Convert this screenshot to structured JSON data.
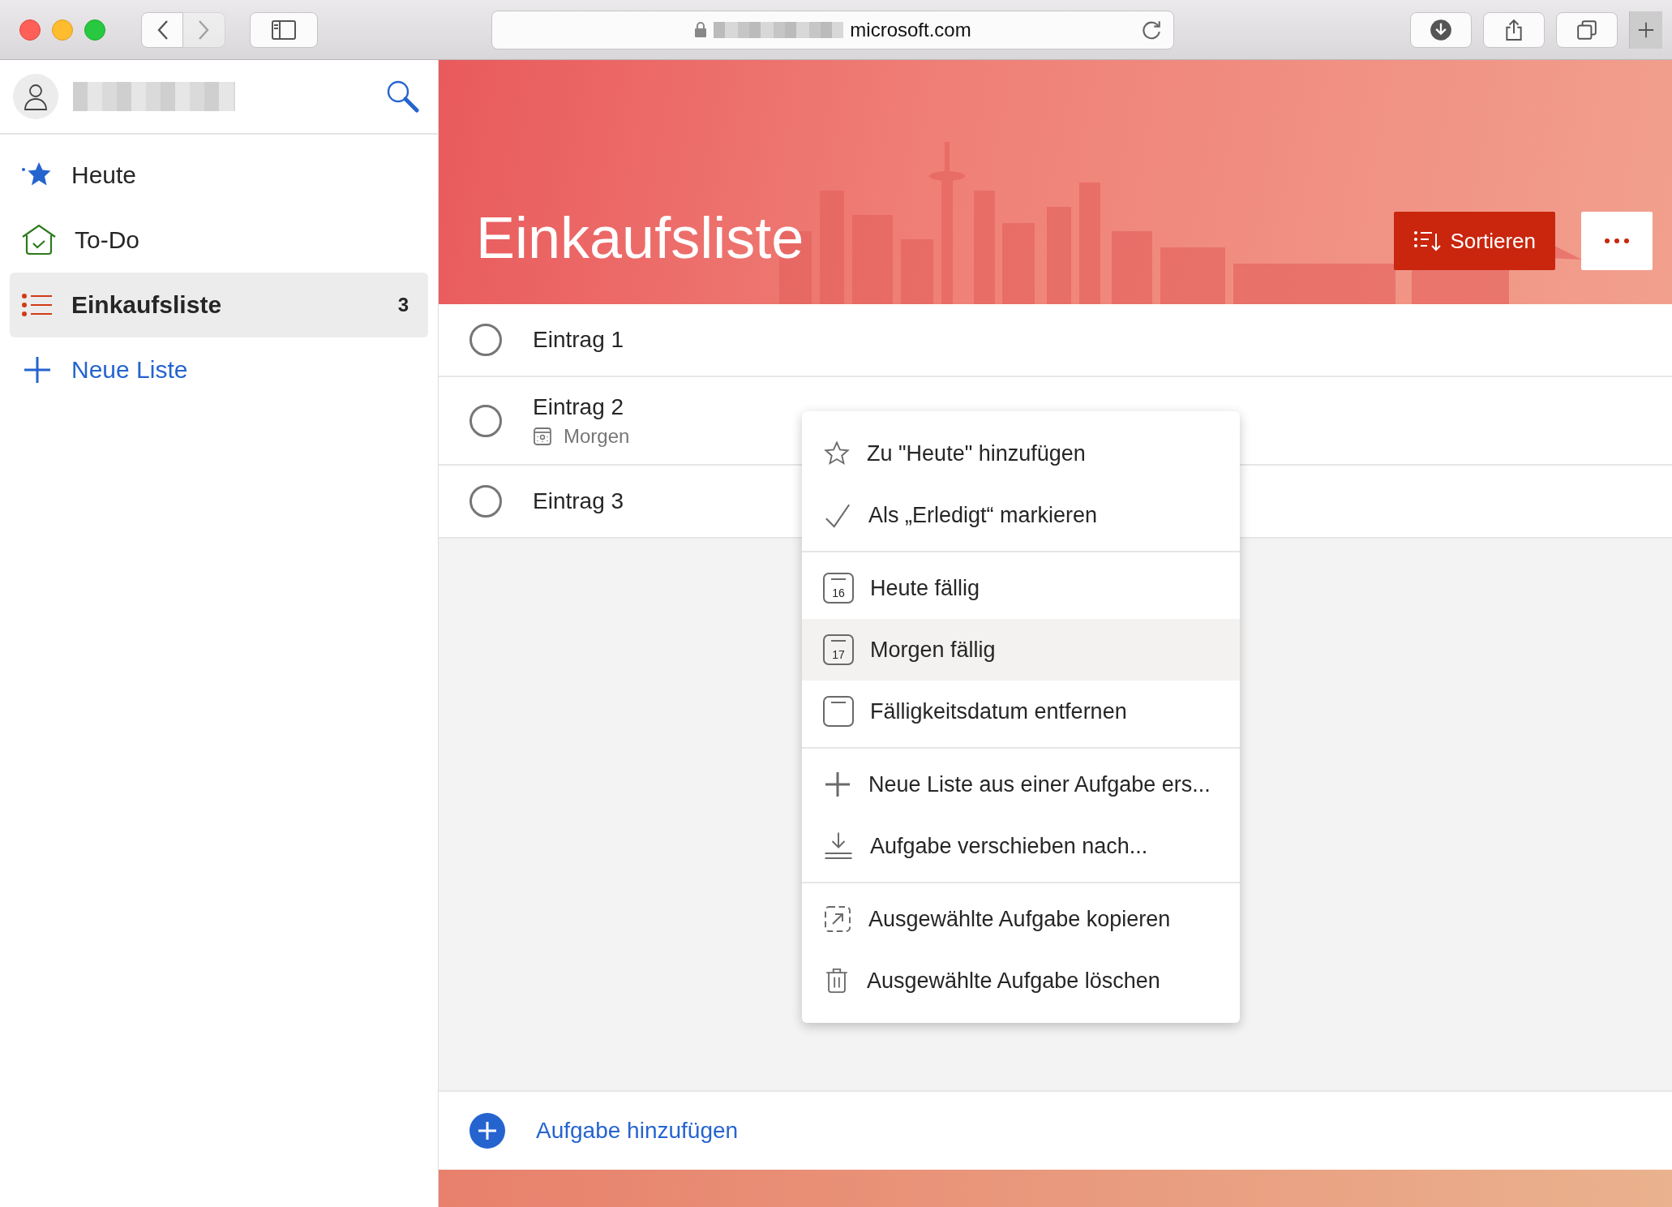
{
  "browser": {
    "nav_buttons": [
      {
        "kind": "back",
        "disabled": false
      },
      {
        "kind": "forward",
        "disabled": true
      }
    ],
    "address": "microsoft.com"
  },
  "sidebar": {
    "items": [
      {
        "label": "Heute",
        "kind": "star",
        "selected": false
      },
      {
        "label": "To-Do",
        "kind": "home",
        "selected": false
      },
      {
        "label": "Einkaufsliste",
        "kind": "list",
        "selected": true,
        "count": "3"
      }
    ],
    "new_list": "Neue Liste"
  },
  "list": {
    "title": "Einkaufsliste",
    "sort_button": "Sortieren",
    "tasks": [
      {
        "title": "Eintrag 1",
        "completed": false
      },
      {
        "title": "Eintrag 2",
        "completed": false,
        "due": "Morgen"
      },
      {
        "title": "Eintrag 3",
        "completed": false
      }
    ],
    "add_task": "Aufgabe hinzufügen"
  },
  "context_menu": {
    "groups": [
      {
        "items": [
          {
            "label": "Zu \"Heute\" hinzufügen",
            "kind": "star",
            "highlighted": false
          },
          {
            "label": "Als „Erledigt“ markieren",
            "kind": "check",
            "highlighted": false
          }
        ]
      },
      {
        "items": [
          {
            "label": "Heute fällig",
            "kind": "calendar",
            "day": "16",
            "highlighted": false
          },
          {
            "label": "Morgen fällig",
            "kind": "calendar",
            "day": "17",
            "highlighted": true
          },
          {
            "label": "Fälligkeitsdatum entfernen",
            "kind": "calendar",
            "highlighted": false
          }
        ]
      },
      {
        "items": [
          {
            "label": "Neue Liste aus einer Aufgabe ers...",
            "kind": "plus",
            "highlighted": false
          },
          {
            "label": "Aufgabe verschieben nach...",
            "kind": "move",
            "highlighted": false
          }
        ]
      },
      {
        "items": [
          {
            "label": "Ausgewählte Aufgabe kopieren",
            "kind": "copy",
            "highlighted": false
          },
          {
            "label": "Ausgewählte Aufgabe löschen",
            "kind": "trash",
            "highlighted": false
          }
        ]
      }
    ]
  }
}
